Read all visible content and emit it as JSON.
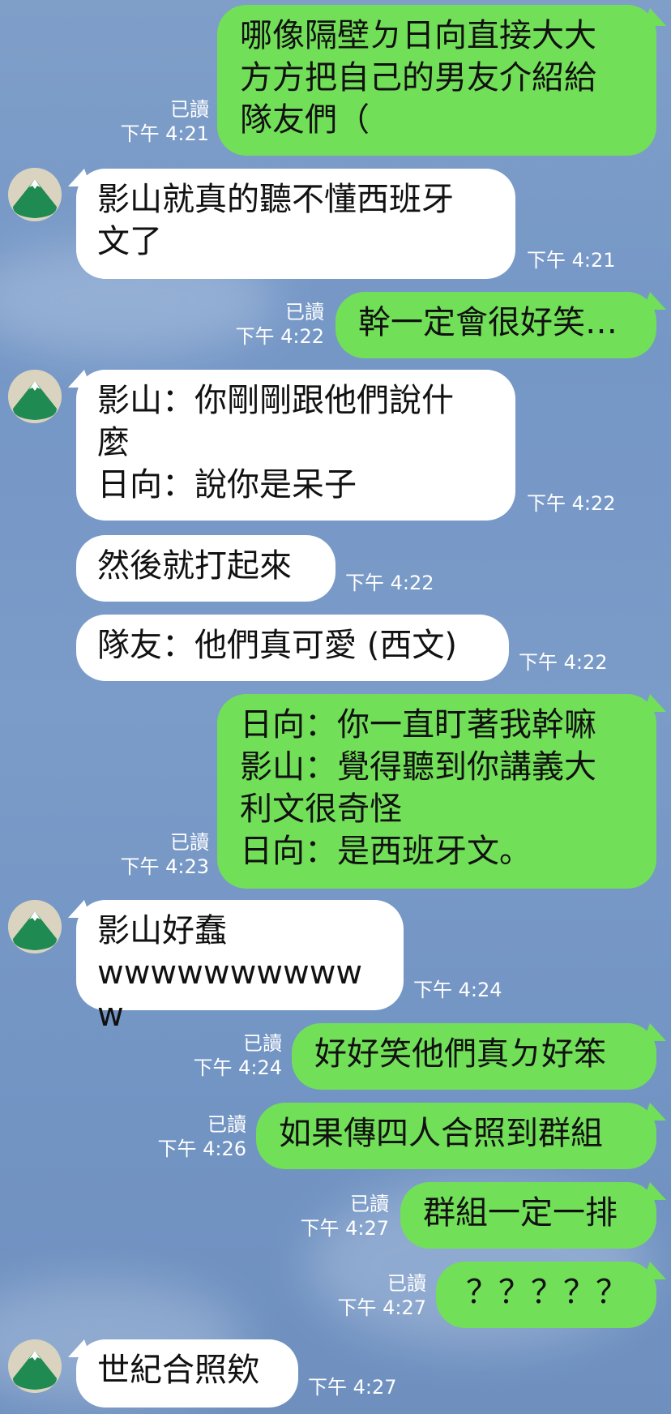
{
  "colors": {
    "sent_bubble": "#72df58",
    "recv_bubble": "#ffffff",
    "meta_text": "#ffffff",
    "avatar_bg": "#d9d3bf",
    "mountain_green": "#1f8a52"
  },
  "avatar_icon": "mountain-icon",
  "messages": [
    {
      "side": "sent",
      "text": "哪像隔壁ㄉ日向直接大大\n方方把自己的男友介紹給\n隊友們（",
      "read": "已讀",
      "time": "下午 4:21"
    },
    {
      "side": "recv",
      "text": "影山就真的聽不懂西班牙\n文了",
      "time": "下午 4:21"
    },
    {
      "side": "sent",
      "text": "幹一定會很好笑…",
      "read": "已讀",
      "time": "下午 4:22"
    },
    {
      "side": "recv",
      "text": "影山：你剛剛跟他們說什\n麼\n日向：說你是呆子",
      "time": "下午 4:22"
    },
    {
      "side": "recv",
      "text": "然後就打起來",
      "time": "下午 4:22"
    },
    {
      "side": "recv",
      "text": "隊友：他們真可愛 (西文)",
      "time": "下午 4:22"
    },
    {
      "side": "sent",
      "text": "日向：你一直盯著我幹嘛\n影山：覺得聽到你講義大\n利文很奇怪\n日向：是西班牙文。",
      "read": "已讀",
      "time": "下午 4:23"
    },
    {
      "side": "recv",
      "text": "影山好蠢\nwwwwwwwwwww",
      "time": "下午 4:24"
    },
    {
      "side": "sent",
      "text": "好好笑他們真ㄉ好笨",
      "read": "已讀",
      "time": "下午 4:24"
    },
    {
      "side": "sent",
      "text": "如果傳四人合照到群組",
      "read": "已讀",
      "time": "下午 4:26"
    },
    {
      "side": "sent",
      "text": "群組一定一排",
      "read": "已讀",
      "time": "下午 4:27"
    },
    {
      "side": "sent",
      "text": "？？？？？",
      "read": "已讀",
      "time": "下午 4:27"
    },
    {
      "side": "recv",
      "text": "世紀合照欸",
      "time": "下午 4:27"
    }
  ]
}
